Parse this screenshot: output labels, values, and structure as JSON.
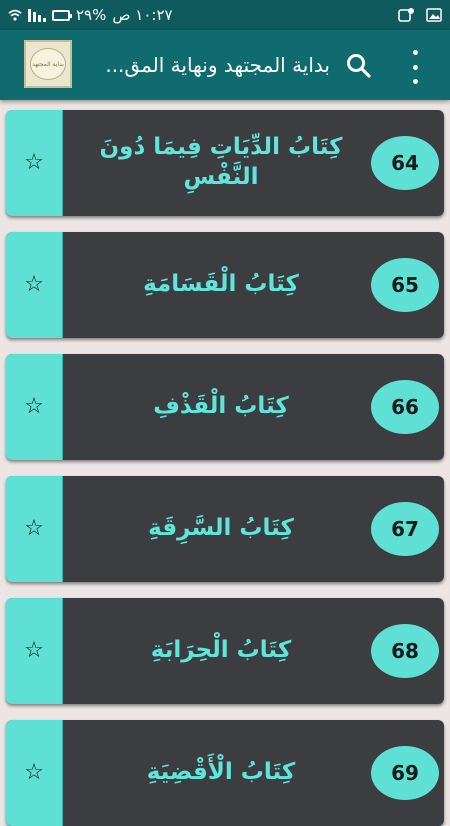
{
  "status_bar": {
    "time": "١٠:٢٧ ص",
    "battery": "%٢٩"
  },
  "toolbar": {
    "title": "بداية المجتهد ونهاية المق...",
    "logo_text": "بداية المجتهد",
    "search_icon": "search-icon",
    "menu_icon": "more-vert-icon"
  },
  "items": [
    {
      "number": "64",
      "title": "كِتَابُ الدِّيَاتِ فِيمَا دُونَ النَّفْسِ"
    },
    {
      "number": "65",
      "title": "كِتَابُ الْقَسَامَةِ"
    },
    {
      "number": "66",
      "title": "كِتَابُ الْقَذْفِ"
    },
    {
      "number": "67",
      "title": "كِتَابُ السَّرِقَةِ"
    },
    {
      "number": "68",
      "title": "كِتَابُ الْحِرَابَةِ"
    },
    {
      "number": "69",
      "title": "كِتَابُ الْأَقْضِيَةِ"
    }
  ],
  "colors": {
    "toolbar": "#0f6b6e",
    "card": "#3c3d41",
    "accent": "#5ee0d5",
    "background": "#ece5e3"
  }
}
